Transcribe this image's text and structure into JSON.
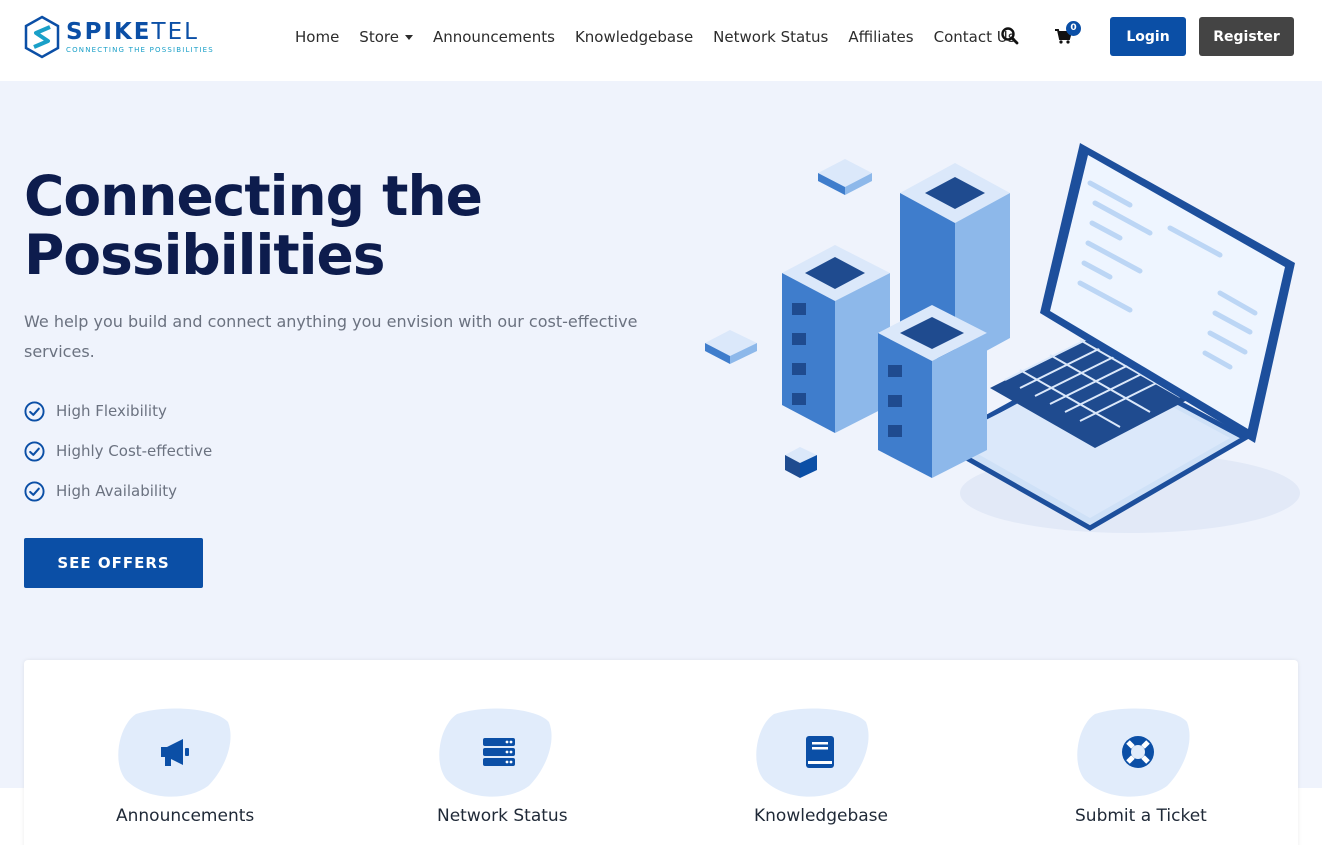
{
  "brand": {
    "name_bold": "SPIKE",
    "name_light": "TEL",
    "tagline": "CONNECTING THE POSSIBILITIES",
    "accent": "#0b4fa6"
  },
  "nav": {
    "items": [
      "Home",
      "Store",
      "Announcements",
      "Knowledgebase",
      "Network Status",
      "Affiliates",
      "Contact Us"
    ],
    "search_icon": "search-icon",
    "cart_icon": "cart-icon",
    "cart_count": "0",
    "login_label": "Login",
    "register_label": "Register"
  },
  "hero": {
    "title": "Connecting the Possibilities",
    "subtitle": "We help you build and connect anything you envision with our cost-effective services.",
    "features": [
      "High Flexibility",
      "Highly Cost-effective",
      "High Availability"
    ],
    "cta_label": "SEE OFFERS",
    "background": "#eff3fc"
  },
  "cards": [
    {
      "label": "Announcements",
      "icon": "megaphone-icon"
    },
    {
      "label": "Network Status",
      "icon": "server-icon"
    },
    {
      "label": "Knowledgebase",
      "icon": "book-icon"
    },
    {
      "label": "Submit a Ticket",
      "icon": "lifebuoy-icon"
    }
  ]
}
